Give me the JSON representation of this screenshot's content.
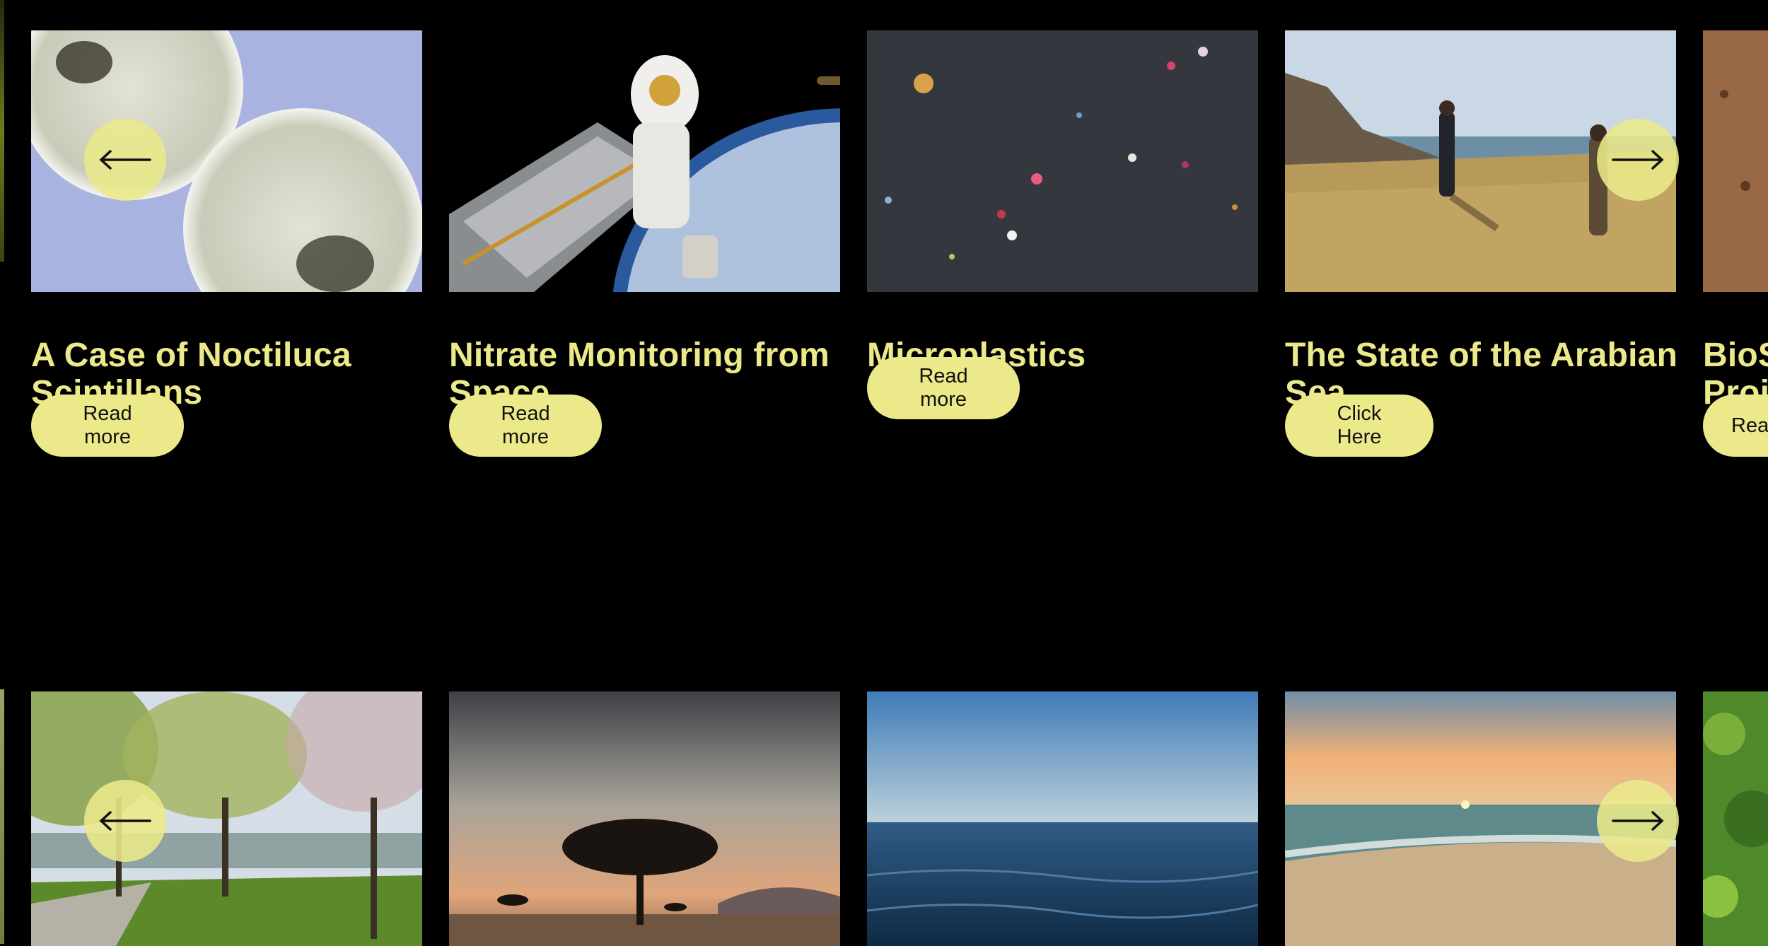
{
  "colors": {
    "accent": "#ebe98a",
    "background": "#000000"
  },
  "row1": {
    "cards": [
      {
        "title": "A Case of Noctiluca Scintillans",
        "button": "Read more",
        "image": "noctiluca-microscope-image"
      },
      {
        "title": "Nitrate Monitoring from Space",
        "button": "Read more",
        "image": "astronaut-space-station-image"
      },
      {
        "title": "Microplastics",
        "button": "Read more",
        "image": "microplastics-sand-image"
      },
      {
        "title": "The State of the Arabian Sea",
        "button": "Click Here",
        "image": "arabian-sea-coast-image"
      },
      {
        "title": "BioS",
        "title_line2": "Proj",
        "button": "Rea",
        "image": "soil-image"
      }
    ],
    "prev_icon": "arrow-left-icon",
    "next_icon": "arrow-right-icon"
  },
  "row2": {
    "cards": [
      {
        "image": "park-trees-image"
      },
      {
        "image": "acacia-sunset-image"
      },
      {
        "image": "open-ocean-image"
      },
      {
        "image": "beach-sunset-image"
      },
      {
        "image": "forest-aerial-image"
      }
    ],
    "prev_icon": "arrow-left-icon",
    "next_icon": "arrow-right-icon"
  }
}
